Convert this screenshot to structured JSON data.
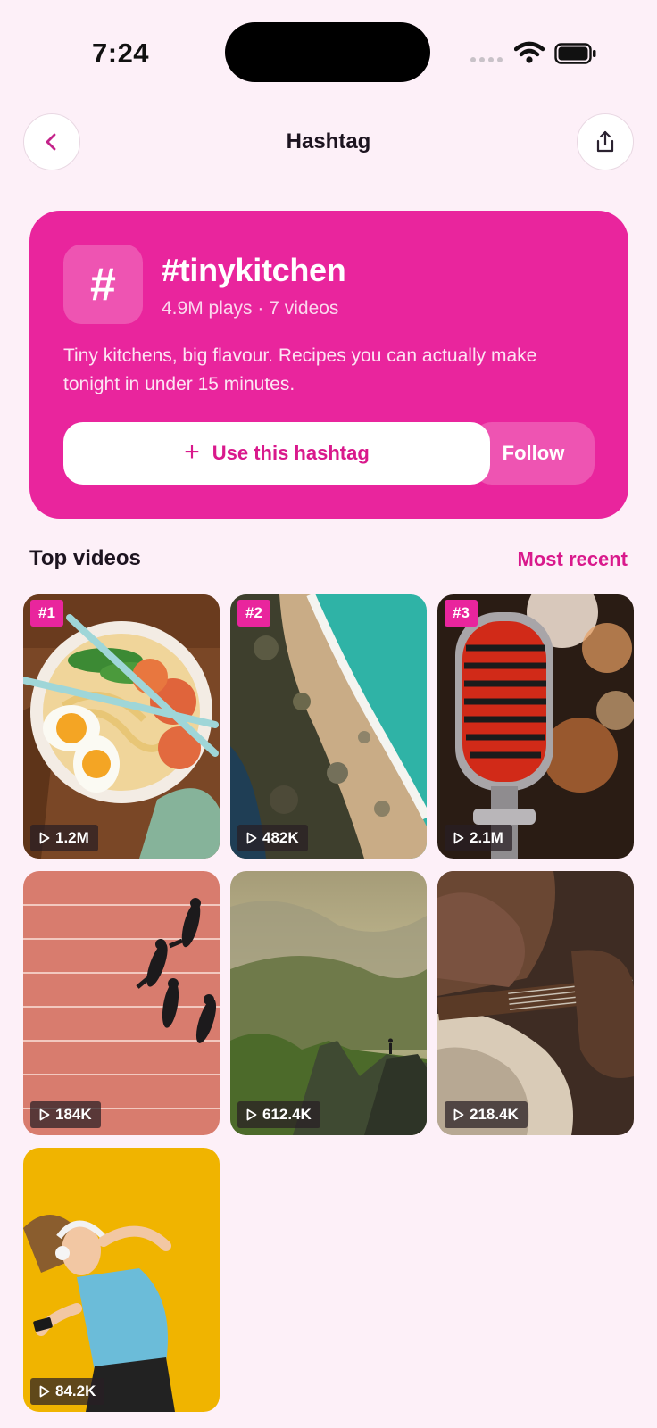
{
  "status": {
    "time": "7:24"
  },
  "header": {
    "title": "Hashtag"
  },
  "hero": {
    "symbol": "#",
    "tag": "#tinykitchen",
    "meta": "4.9M plays · 7 videos",
    "description": "Tiny kitchens, big flavour. Recipes you can actually make tonight in under 15 minutes.",
    "use_label": "Use this hashtag",
    "follow_label": "Follow",
    "accent": "#e9259d"
  },
  "section": {
    "title": "Top videos",
    "sort_label": "Most recent"
  },
  "videos": [
    {
      "rank": "#1",
      "views": "1.2M",
      "icon": "ramen-bowl"
    },
    {
      "rank": "#2",
      "views": "482K",
      "icon": "aerial-beach"
    },
    {
      "rank": "#3",
      "views": "2.1M",
      "icon": "microphone"
    },
    {
      "views": "184K",
      "icon": "runners-track"
    },
    {
      "views": "612.4K",
      "icon": "mountain-hiker"
    },
    {
      "views": "218.4K",
      "icon": "guitar"
    },
    {
      "views": "84.2K",
      "icon": "dancing-headphones"
    }
  ]
}
